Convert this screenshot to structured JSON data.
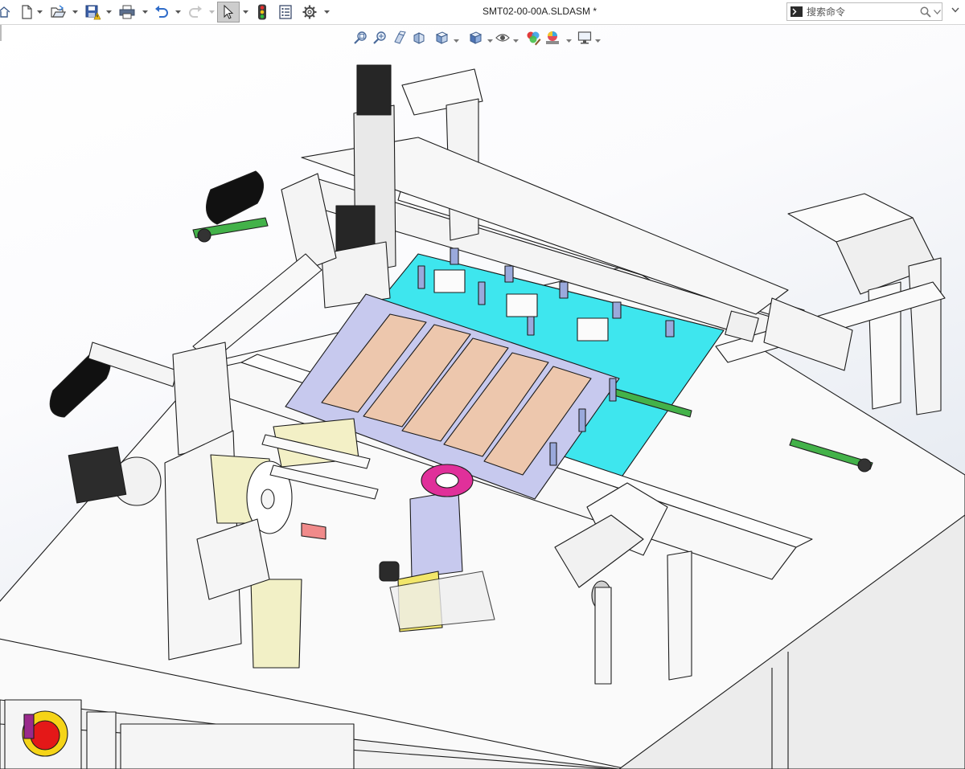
{
  "window": {
    "document_title": "SMT02-00-00A.SLDASM *"
  },
  "toolbar": {
    "items": [
      {
        "name": "home-icon",
        "kind": "button"
      },
      {
        "name": "new-document-icon",
        "kind": "button",
        "dropdown": true
      },
      {
        "name": "open-folder-icon",
        "kind": "button",
        "dropdown": true
      },
      {
        "name": "save-warning-icon",
        "kind": "button",
        "dropdown": true
      },
      {
        "name": "print-icon",
        "kind": "button",
        "dropdown": true
      },
      {
        "name": "undo-icon",
        "kind": "button",
        "dropdown": true
      },
      {
        "name": "redo-icon",
        "kind": "button",
        "disabled": true,
        "dropdown": true
      },
      {
        "name": "select-pointer-icon",
        "kind": "button",
        "active": true,
        "dropdown": true
      },
      {
        "name": "rebuild-traffic-light-icon",
        "kind": "button"
      },
      {
        "name": "file-properties-icon",
        "kind": "button"
      },
      {
        "name": "options-gear-icon",
        "kind": "button",
        "dropdown": true
      }
    ]
  },
  "search": {
    "placeholder": "搜索命令",
    "value": "",
    "icons": [
      "command-prompt-icon",
      "search-icon",
      "chevron-down-icon"
    ]
  },
  "heads_up_toolbar": {
    "items": [
      "zoom-to-fit-icon",
      "zoom-to-area-icon",
      "previous-view-icon",
      "section-view-icon",
      "view-orientation-icon",
      "display-style-icon",
      "hide-show-items-icon",
      "edit-appearance-icon",
      "apply-scene-icon",
      "view-settings-icon"
    ]
  },
  "colors": {
    "toolbar_bg": "#ffffff",
    "viewport_gradient_end": "#dde3ec",
    "fixture_plate": "#3ee6ee",
    "stencil_frame": "#c7c9ee",
    "pcb_pads": "#edc7ad",
    "tape_roll": "#f2f0c6",
    "magenta_cup": "#e0309a",
    "motor_black": "#262626",
    "bracket_yellow": "#f2e66a",
    "estop_red": "#e41818",
    "estop_yellow": "#f5d417",
    "estop_purple": "#9a2a8c"
  }
}
